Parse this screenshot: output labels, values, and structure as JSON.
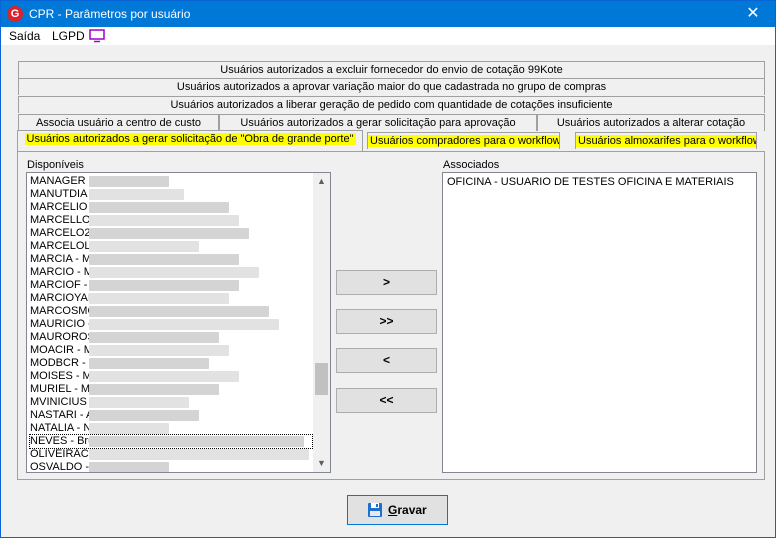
{
  "window": {
    "title": "CPR - Parâmetros por usuário",
    "app_icon_glyph": "G",
    "close_glyph": "✕"
  },
  "menu": {
    "saida": "Saída",
    "lgpd": "LGPD"
  },
  "tabs": {
    "row1": "Usuários autorizados a excluir fornecedor do envio de cotação 99Kote",
    "row2": "Usuários autorizados a aprovar variação maior do que cadastrada no grupo de compras",
    "row3": "Usuários autorizados a liberar geração de pedido com quantidade de cotações insuficiente",
    "row4": [
      "Associa usuário a centro de custo",
      "Usuários autorizados a gerar solicitação para aprovação",
      "Usuários autorizados a alterar cotação"
    ],
    "row5": [
      "Usuários autorizados a gerar solicitação de \"Obra de grande porte\"",
      "Usuários compradores para o workflow",
      "Usuários almoxarifes para o workflow"
    ]
  },
  "disponiveis": {
    "label": "Disponíveis",
    "items": [
      "MANAGER",
      "MANUTDIA",
      "MARCELIO",
      "MARCELLO",
      "MARCELO2",
      "MARCELOL",
      "MARCIA - M",
      "MARCIO - M",
      "MARCIOF -",
      "MARCIOYAI",
      "MARCOSMC",
      "MAURICIO -",
      "MAUROROS",
      "MOACIR - M",
      "MODBCR - I",
      "MOISES - M",
      "MURIEL - M",
      "MVINICIUS",
      "NASTARI - A",
      "NATALIA - N",
      "NEVES - Bru",
      "OLIVEIRACI",
      "OSVALDO -"
    ]
  },
  "associados": {
    "label": "Associados",
    "items": [
      "OFICINA - USUARIO DE TESTES OFICINA E MATERIAIS"
    ]
  },
  "buttons": {
    "add_one": ">",
    "add_all": ">>",
    "remove_one": "<",
    "remove_all": "<<",
    "gravar_first": "G",
    "gravar_rest": "ravar"
  },
  "colors": {
    "titlebar": "#0078d7",
    "highlight": "#ffff00",
    "app_icon": "#d9232d",
    "monitor_icon": "#a000c8"
  }
}
